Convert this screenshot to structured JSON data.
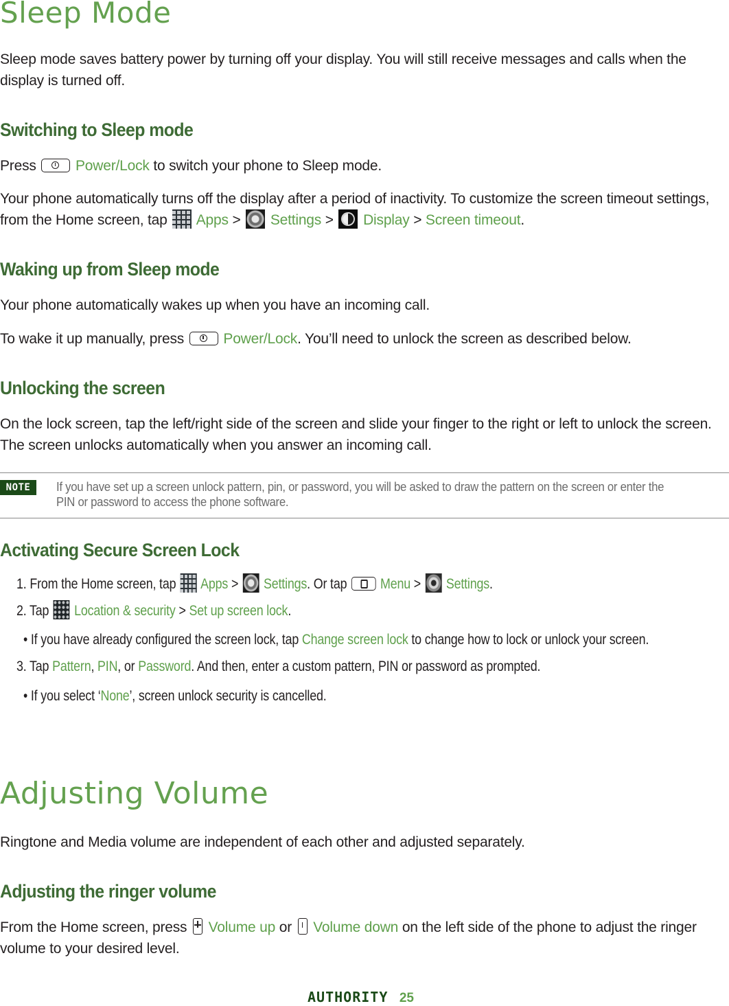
{
  "sleep": {
    "title": "Sleep Mode",
    "intro_1": "Sleep mode saves battery power by turning off your display. You will still receive messages and calls when the",
    "intro_2": "display is turned off.",
    "switching": {
      "heading": "Switching to Sleep mode",
      "press_prefix": "Press",
      "power_link": "Power/Lock",
      "press_suffix": "to switch your phone to Sleep mode.",
      "auto_1": "Your phone automatically turns off the display after a period of inactivity. To customize the screen timeout settings,",
      "auto_2_prefix": "from the Home screen, tap",
      "apps": "Apps",
      "settings": "Settings",
      "display": "Display",
      "screen_timeout": "Screen timeout",
      "sep": ">",
      "end": "."
    },
    "waking": {
      "heading": "Waking up from Sleep mode",
      "auto": "Your phone automatically wakes up when you have an incoming call.",
      "manual_prefix": "To wake it up manually, press",
      "power_link": "Power/Lock",
      "manual_suffix": ". You’ll need to unlock the screen as described below."
    },
    "unlocking": {
      "heading": "Unlocking the screen",
      "line_1": "On the lock screen, tap the left/right side of the screen and slide your finger to the right or left to unlock the screen.",
      "line_2": "The screen unlocks automatically when you answer an incoming call.",
      "note_badge": "NOTE",
      "note_line_1": "If you have set up a screen unlock pattern, pin, or password, you will be asked to draw the pattern on the screen or enter the",
      "note_line_2": "PIN or password to access the phone software."
    },
    "secure": {
      "heading": "Activating Secure Screen Lock",
      "step1_prefix": "1. From the Home screen, tap",
      "apps": "Apps",
      "settings": "Settings",
      "or_tap": ". Or tap",
      "menu": "Menu",
      "step2_prefix": "2. Tap",
      "location_security": "Location & security",
      "set_up_lock": "Set up screen lock",
      "bullet1_prefix": "• If you have already configured the screen lock, tap",
      "change_lock": "Change screen lock",
      "bullet1_suffix": "to change how to lock or unlock your screen.",
      "step3_prefix": "3. Tap",
      "pattern": "Pattern",
      "pin": "PIN",
      "or": ", or",
      "password": "Password",
      "step3_suffix": ". And then, enter a custom pattern, PIN or password as prompted.",
      "bullet2_prefix": "• If you select ‘",
      "none": "None",
      "bullet2_suffix": "’, screen unlock security is cancelled."
    }
  },
  "volume": {
    "title": "Adjusting Volume",
    "intro": "Ringtone and Media volume are independent of each other and adjusted separately.",
    "ringer": {
      "heading": "Adjusting the ringer volume",
      "line_prefix": "From the Home screen, press",
      "volume_up": "Volume up",
      "or": "or",
      "volume_down": "Volume down",
      "line_suffix": "on the left side of the phone to adjust the ringer",
      "line_2": "volume to your desired level."
    }
  },
  "footer": {
    "brand": "AUTHORITY",
    "page_number": "25"
  },
  "colors": {
    "title_green": "#64a14f",
    "heading_green": "#3e6b35",
    "link_green": "#5fa04c",
    "badge_green": "#1b4a18"
  }
}
